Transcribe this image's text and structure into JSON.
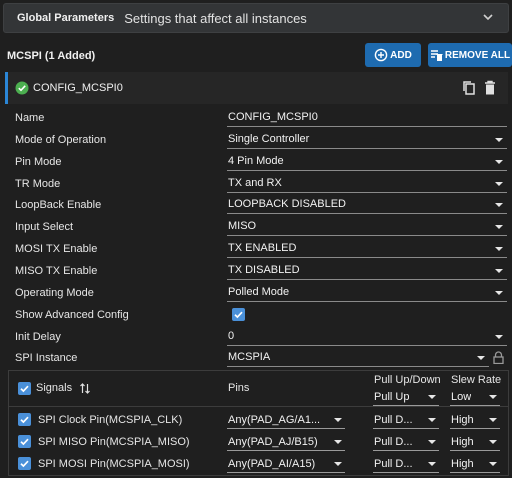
{
  "global": {
    "title": "Global Parameters",
    "description": "Settings that affect all instances"
  },
  "module": {
    "title": "MCSPI (1 Added)",
    "add_label": "ADD",
    "remove_label": "REMOVE ALL"
  },
  "config": {
    "name": "CONFIG_MCSPI0"
  },
  "fields": [
    {
      "label": "Name",
      "value": "CONFIG_MCSPI0",
      "type": "text"
    },
    {
      "label": "Mode of Operation",
      "value": "Single Controller",
      "type": "select"
    },
    {
      "label": "Pin Mode",
      "value": "4 Pin Mode",
      "type": "select"
    },
    {
      "label": "TR Mode",
      "value": "TX and RX",
      "type": "select"
    },
    {
      "label": "LoopBack Enable",
      "value": "LOOPBACK DISABLED",
      "type": "select"
    },
    {
      "label": "Input Select",
      "value": "MISO",
      "type": "select"
    },
    {
      "label": "MOSI TX Enable",
      "value": "TX ENABLED",
      "type": "select"
    },
    {
      "label": "MISO TX Enable",
      "value": "TX DISABLED",
      "type": "select"
    },
    {
      "label": "Operating Mode",
      "value": "Polled Mode",
      "type": "select"
    },
    {
      "label": "Show Advanced Config",
      "value": "",
      "type": "checkbox",
      "checked": true
    },
    {
      "label": "Init Delay",
      "value": "0",
      "type": "select"
    },
    {
      "label": "SPI Instance",
      "value": "MCSPIA",
      "type": "select-locked"
    }
  ],
  "signals": {
    "header": {
      "signals": "Signals",
      "pins": "Pins",
      "pull": "Pull Up/Down",
      "pull_default": "Pull Up",
      "slew": "Slew Rate",
      "slew_default": "Low"
    },
    "rows": [
      {
        "name": "SPI Clock Pin(MCSPIA_CLK)",
        "pin": "Any(PAD_AG/A1...",
        "pull": "Pull D...",
        "slew": "High"
      },
      {
        "name": "SPI MISO Pin(MCSPIA_MISO)",
        "pin": "Any(PAD_AJ/B15)",
        "pull": "Pull D...",
        "slew": "High"
      },
      {
        "name": "SPI MOSI Pin(MCSPIA_MOSI)",
        "pin": "Any(PAD_AI/A15)",
        "pull": "Pull D...",
        "slew": "High"
      }
    ]
  },
  "colors": {
    "accent": "#1e6bb0",
    "check": "#4a90d9",
    "success": "#4caf50"
  }
}
